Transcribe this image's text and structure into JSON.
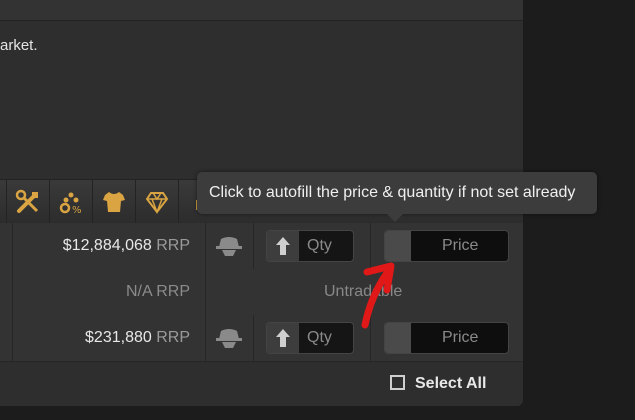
{
  "description_text": "arket.",
  "category_icons": [
    "tools-icon",
    "ammo-icon",
    "clothing-icon",
    "jewelry-icon",
    "partial-icon"
  ],
  "rows": [
    {
      "price": "$12,884,068",
      "rrp": "RRP",
      "qty_placeholder": "Qty",
      "price_placeholder": "Price"
    },
    {
      "na": "N/A RRP",
      "untradable": "Untradable"
    },
    {
      "price": "$231,880",
      "rrp": "RRP",
      "qty_placeholder": "Qty",
      "price_placeholder": "Price"
    }
  ],
  "footer": {
    "select_all": "Select All"
  },
  "tooltip": {
    "text": "Click to autofill the price & quantity if not set already"
  },
  "colors": {
    "icon_gold": "#d9a441",
    "annotation_red": "#e01818"
  }
}
